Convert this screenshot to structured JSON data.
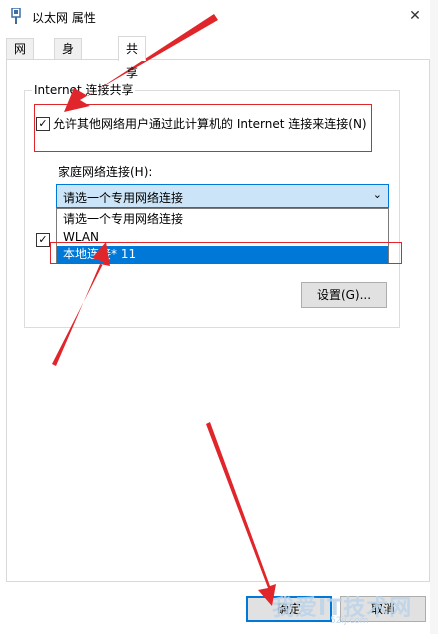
{
  "window": {
    "title": "以太网 属性"
  },
  "tabs": [
    {
      "label": "网络"
    },
    {
      "label": "身份验证"
    },
    {
      "label": "共享"
    }
  ],
  "ics": {
    "group_title": "Internet 连接共享",
    "allow_checkbox_label": "允许其他网络用户通过此计算机的 Internet 连接来连接(N)",
    "allow_checked": true,
    "home_label": "家庭网络连接(H):",
    "dropdown_value": "请选一个专用网络连接",
    "dropdown_options": [
      "请选一个专用网络连接",
      "WLAN",
      "本地连接* 11"
    ],
    "selected_option": "本地连接* 11",
    "second_checked": true,
    "settings_button": "设置(G)..."
  },
  "footer": {
    "ok_button": "确定",
    "cancel_button": "取消"
  },
  "watermark": {
    "text": "我爱IT技术网",
    "sub": "52ij.com"
  },
  "colors": {
    "accent": "#0078d7",
    "annotation": "#e0262a"
  }
}
